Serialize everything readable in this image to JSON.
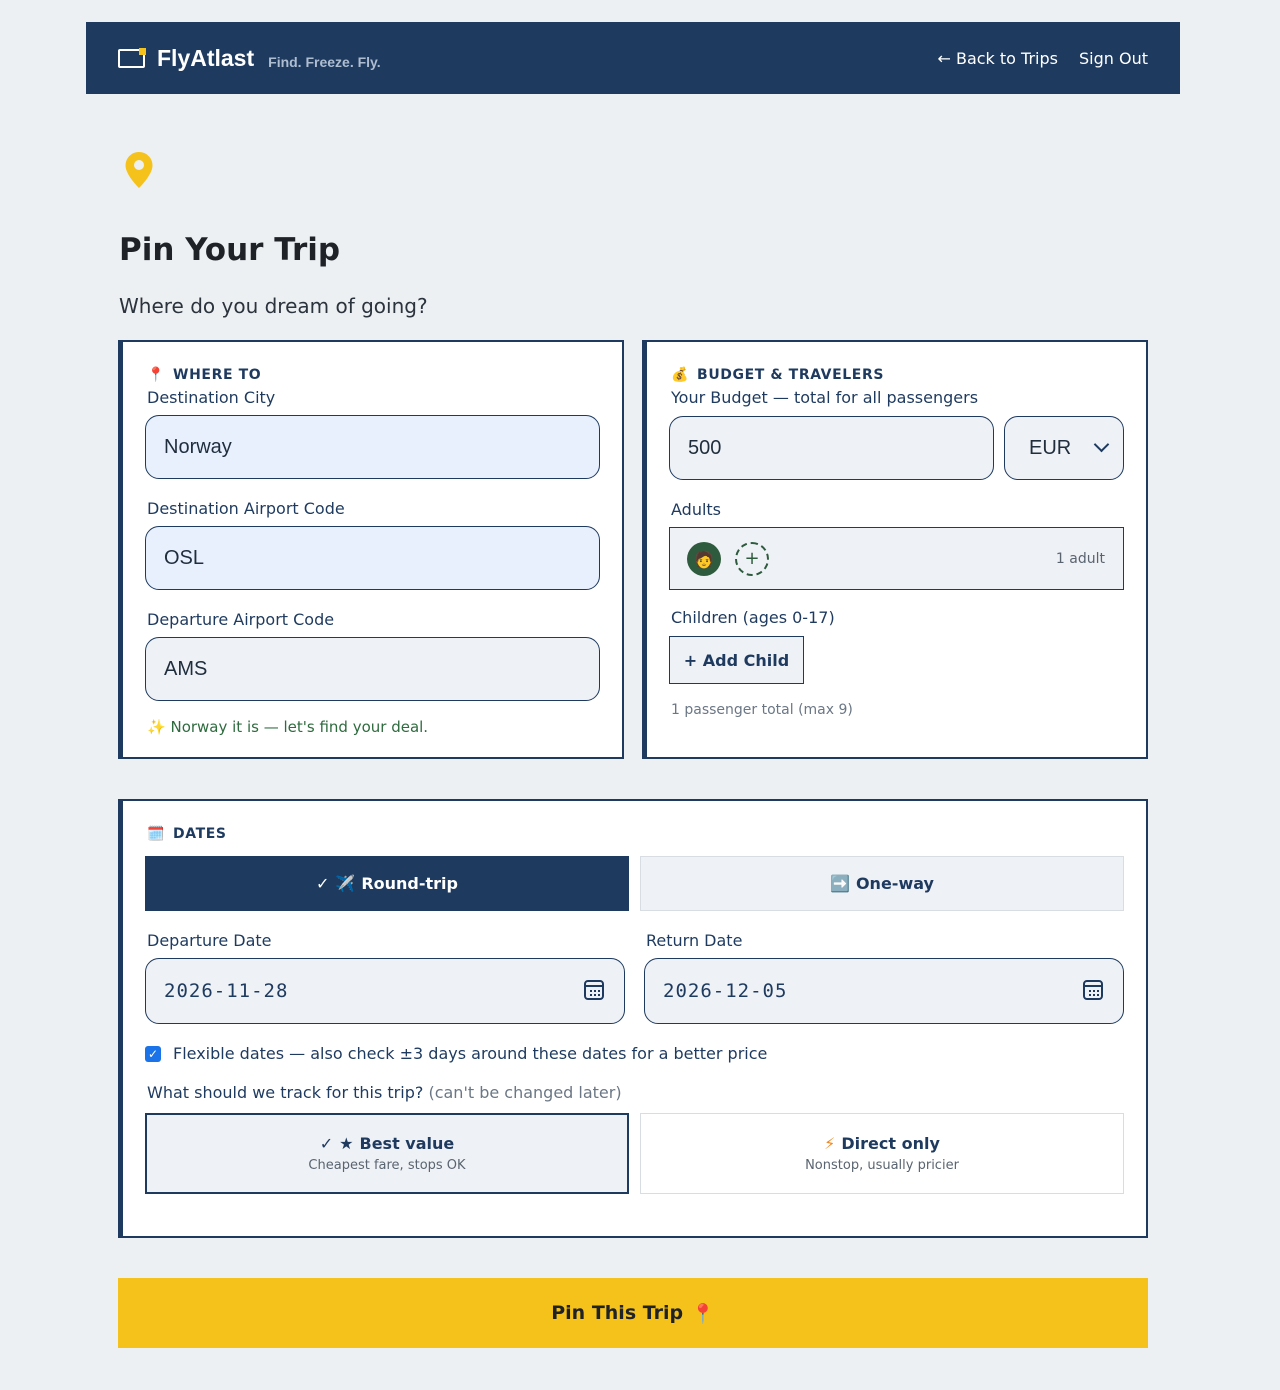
{
  "header": {
    "brand": "FlyAtlast",
    "tagline": "Find. Freeze. Fly.",
    "nav": {
      "back": "← Back to Trips",
      "signout": "Sign Out"
    }
  },
  "page": {
    "title": "Pin Your Trip",
    "subtitle": "Where do you dream of going?"
  },
  "where": {
    "section_emoji": "📍",
    "section_title": "WHERE TO",
    "city_label": "Destination City",
    "city_value": "Norway",
    "dest_code_label": "Destination Airport Code",
    "dest_code_value": "OSL",
    "dep_code_label": "Departure Airport Code",
    "dep_code_value": "AMS",
    "hint_emoji": "✨",
    "hint": "Norway it is — let's find your deal."
  },
  "budget": {
    "section_emoji": "💰",
    "section_title": "BUDGET & TRAVELERS",
    "budget_label": "Your Budget — total for all passengers",
    "budget_value": "500",
    "currency": "EUR",
    "adults_label": "Adults",
    "adult_avatar": "🧑",
    "add_adult_symbol": "+",
    "adults_count": "1 adult",
    "children_label": "Children (ages 0-17)",
    "add_child": "+ Add Child",
    "passenger_total": "1 passenger total (max 9)"
  },
  "dates": {
    "section_emoji": "🗓️",
    "section_title": "DATES",
    "trip_types": [
      {
        "check": "✓",
        "emoji": "✈️",
        "label": "Round-trip",
        "active": true
      },
      {
        "emoji": "➡️",
        "label": "One-way",
        "active": false
      }
    ],
    "departure_label": "Departure Date",
    "departure_value": "2026-11-28",
    "return_label": "Return Date",
    "return_value": "2026-12-05",
    "flexible_checked": "✓",
    "flexible_label": "Flexible dates — also check ±3 days around these dates for a better price",
    "track_question": "What should we track for this trip?",
    "track_note": "(can't be changed later)",
    "track_options": [
      {
        "check": "✓",
        "icon": "★",
        "title": "Best value",
        "subtitle": "Cheapest fare, stops OK",
        "selected": true
      },
      {
        "icon": "⚡",
        "title": "Direct only",
        "subtitle": "Nonstop, usually pricier",
        "selected": false
      }
    ]
  },
  "submit": {
    "label": "Pin This Trip",
    "emoji": "📍"
  },
  "colors": {
    "navy": "#1e3a5f",
    "accent_yellow": "#f5c21b",
    "background": "#edf0f3",
    "highlight_input": "#e8f0fe",
    "success_text": "#2e6b3e"
  }
}
